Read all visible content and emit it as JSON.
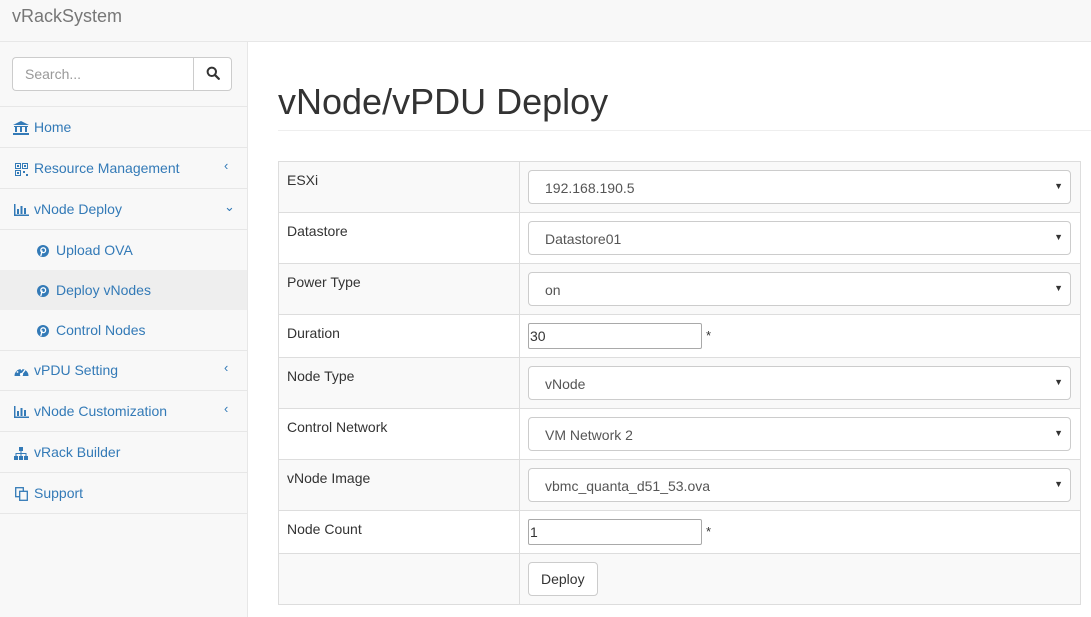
{
  "app": {
    "brand": "vRackSystem"
  },
  "search": {
    "placeholder": "Search..."
  },
  "sidebar": {
    "items": [
      {
        "label": "Home",
        "icon": "bank-icon"
      },
      {
        "label": "Resource Management",
        "icon": "qrcode-icon",
        "arrow": "‹"
      },
      {
        "label": "vNode Deploy",
        "icon": "bar-chart-icon",
        "arrow": "⌄"
      },
      {
        "label": "vPDU Setting",
        "icon": "dashboard-icon",
        "arrow": "‹"
      },
      {
        "label": "vNode Customization",
        "icon": "bar-chart-icon",
        "arrow": "‹"
      },
      {
        "label": "vRack Builder",
        "icon": "sitemap-icon"
      },
      {
        "label": "Support",
        "icon": "copy-icon"
      }
    ],
    "submenu": [
      {
        "label": "Upload OVA",
        "icon": "pinterest-icon"
      },
      {
        "label": "Deploy vNodes",
        "icon": "pinterest-icon",
        "active": true
      },
      {
        "label": "Control Nodes",
        "icon": "pinterest-icon"
      }
    ]
  },
  "main": {
    "title": "vNode/vPDU Deploy",
    "fields": {
      "esxi": {
        "label": "ESXi",
        "value": "192.168.190.5"
      },
      "datastore": {
        "label": "Datastore",
        "value": "Datastore01"
      },
      "power_type": {
        "label": "Power Type",
        "value": "on"
      },
      "duration": {
        "label": "Duration",
        "value": "30",
        "required": "*"
      },
      "node_type": {
        "label": "Node Type",
        "value": "vNode"
      },
      "control_network": {
        "label": "Control Network",
        "value": "VM Network 2"
      },
      "vnode_image": {
        "label": "vNode Image",
        "value": "vbmc_quanta_d51_53.ova"
      },
      "node_count": {
        "label": "Node Count",
        "value": "1",
        "required": "*"
      }
    },
    "deploy_label": "Deploy"
  },
  "colors": {
    "link": "#337ab7",
    "sidebar_bg": "#f8f8f8",
    "active_bg": "#eeeeee"
  }
}
